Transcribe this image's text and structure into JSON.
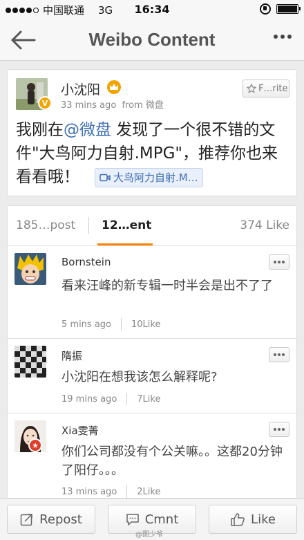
{
  "status_bar": {
    "carrier": "中国联通",
    "network": "3G",
    "time": "16:34"
  },
  "nav": {
    "title": "Weibo Content"
  },
  "post": {
    "author": "小沈阳",
    "time": "33 mins ago",
    "source": "from 微盘",
    "favorite_label": "F…rite",
    "text_before": "我刚在",
    "mention": "@微盘",
    "text_after": " 发现了一个很不错的文件\"大鸟阿力自射.MPG\"，推荐你也来看看哦！",
    "attachment_label": "大鸟阿力自射.M…"
  },
  "tabs": {
    "repost": "185…post",
    "comment": "12…ent",
    "like": "374 Like"
  },
  "comments": [
    {
      "name": "Bornstein",
      "text": "看来汪峰的新专辑一时半会是出不了了",
      "time": "5 mins ago",
      "likes": "10Like"
    },
    {
      "name": "隋振",
      "text": "小沈阳在想我该怎么解释呢?",
      "time": "19 mins ago",
      "likes": "7Like"
    },
    {
      "name": "Xia雯菁",
      "text": "你们公司都没有个公关嘛。。这都20分钟了阳仔。。。",
      "time": "13 mins ago",
      "likes": "2Like"
    }
  ],
  "toolbar": {
    "repost": "Repost",
    "comment": "Cmnt",
    "like": "Like"
  },
  "watermark": "@图少爷",
  "colors": {
    "accent": "#ff8200",
    "link": "#3d6eb5",
    "vip_badge": "#f2a400"
  }
}
